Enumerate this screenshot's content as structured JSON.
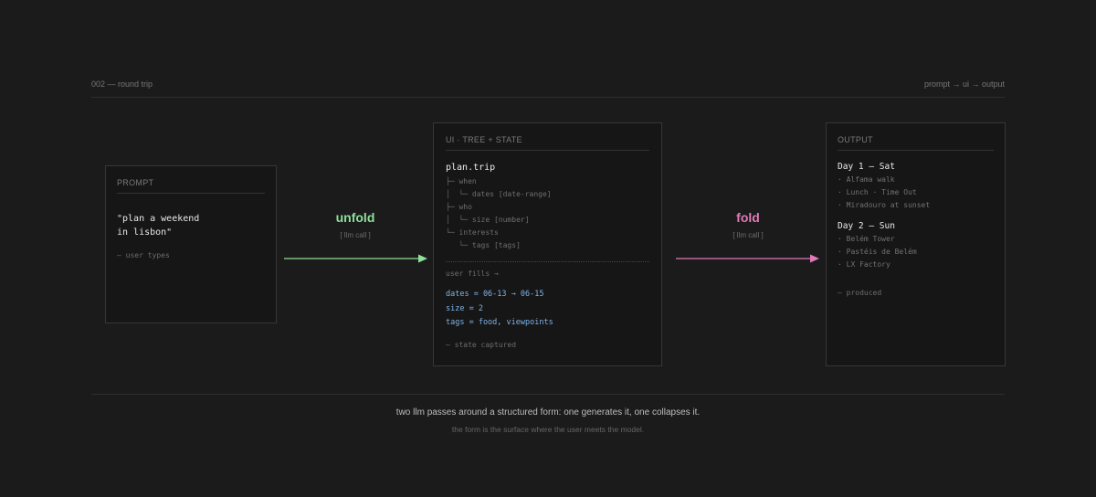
{
  "header": {
    "left": "002 — round trip",
    "right": "prompt → ui → output"
  },
  "prompt_card": {
    "title": "PROMPT",
    "text": "\"plan a weekend\nin lisbon\"",
    "note": "— user types"
  },
  "unfold": {
    "label": "unfold",
    "sub": "[ llm call ]",
    "color": "#8ee09a"
  },
  "ui_card": {
    "title": "UI · TREE + STATE",
    "root": "plan.trip",
    "tree": [
      "├─ when",
      "│  └─ dates [date-range]",
      "├─ who",
      "│  └─ size [number]",
      "└─ interests",
      "   └─ tags [tags]"
    ],
    "fills_label": "user fills →",
    "state": [
      "dates = 06-13 → 06-15",
      "size = 2",
      "tags = food, viewpoints"
    ],
    "note": "— state captured"
  },
  "fold": {
    "label": "fold",
    "sub": "[ llm call ]",
    "color": "#e07ab8"
  },
  "output_card": {
    "title": "OUTPUT",
    "day1": {
      "title": "Day 1 — Sat",
      "items": [
        "· Alfama walk",
        "· Lunch · Time Out",
        "· Miradouro at sunset"
      ]
    },
    "day2": {
      "title": "Day 2 — Sun",
      "items": [
        "· Belém Tower",
        "· Pastéis de Belém",
        "· LX Factory"
      ]
    },
    "note": "— produced"
  },
  "footer": {
    "main": "two llm passes around a structured form: one generates it, one collapses it.",
    "sub": "the form is the surface where the user meets the model."
  }
}
